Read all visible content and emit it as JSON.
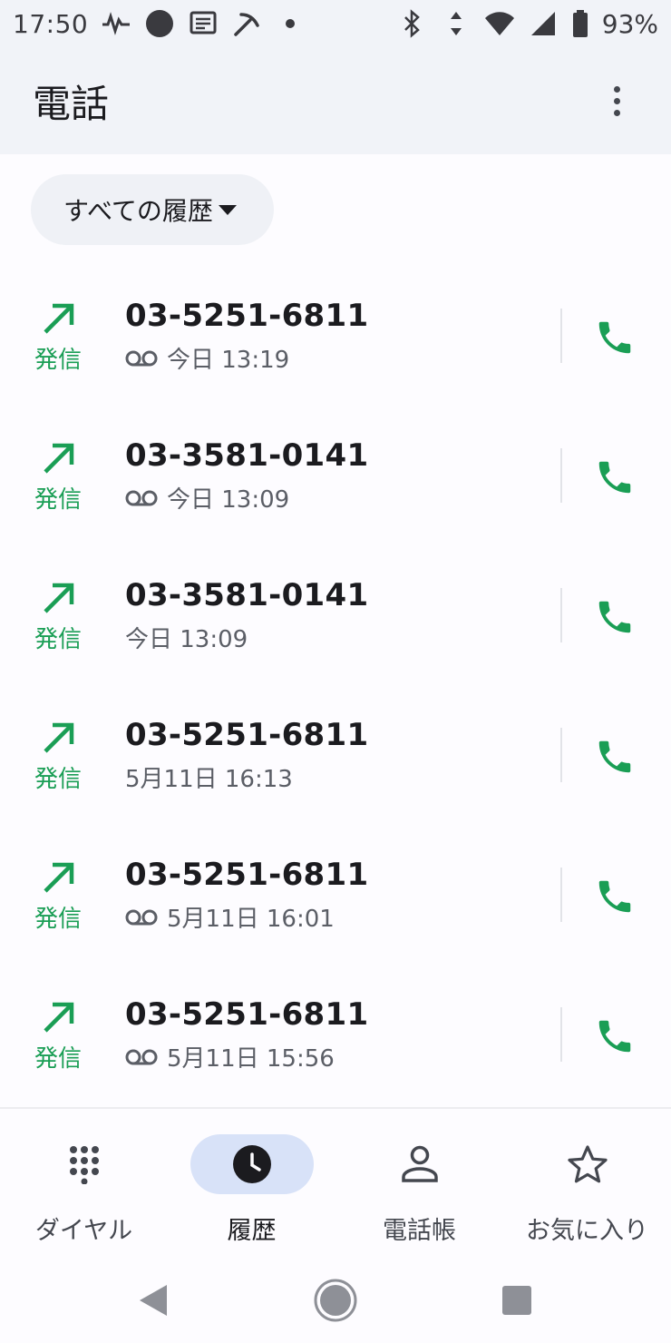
{
  "status_bar": {
    "time": "17:50",
    "battery": "93%",
    "icons_left": [
      "activity-icon",
      "circle-icon",
      "message-icon",
      "pickaxe-icon",
      "dot-icon"
    ],
    "icons_right": [
      "bluetooth-icon",
      "data-arrows-icon",
      "wifi-icon",
      "signal-icon",
      "battery-icon"
    ]
  },
  "app_bar": {
    "title": "電話",
    "overflow_icon": "more-vert-icon"
  },
  "filter": {
    "label": "すべての履歴"
  },
  "calls": [
    {
      "number": "03-5251-6811",
      "type_label": "発信",
      "time": "今日 13:19",
      "voicemail": true
    },
    {
      "number": "03-3581-0141",
      "type_label": "発信",
      "time": "今日 13:09",
      "voicemail": true
    },
    {
      "number": "03-3581-0141",
      "type_label": "発信",
      "time": "今日 13:09",
      "voicemail": false
    },
    {
      "number": "03-5251-6811",
      "type_label": "発信",
      "time": "5月11日 16:13",
      "voicemail": false
    },
    {
      "number": "03-5251-6811",
      "type_label": "発信",
      "time": "5月11日 16:01",
      "voicemail": true
    },
    {
      "number": "03-5251-6811",
      "type_label": "発信",
      "time": "5月11日 15:56",
      "voicemail": true
    }
  ],
  "bottom_nav": {
    "items": [
      {
        "label": "ダイヤル",
        "icon": "dialpad-icon",
        "active": false
      },
      {
        "label": "履歴",
        "icon": "clock-icon",
        "active": true
      },
      {
        "label": "電話帳",
        "icon": "person-icon",
        "active": false
      },
      {
        "label": "お気に入り",
        "icon": "star-icon",
        "active": false
      }
    ]
  },
  "colors": {
    "accent_green": "#1a9e55",
    "active_pill": "#d8e2f8",
    "header_bg": "#f1f3f8"
  }
}
